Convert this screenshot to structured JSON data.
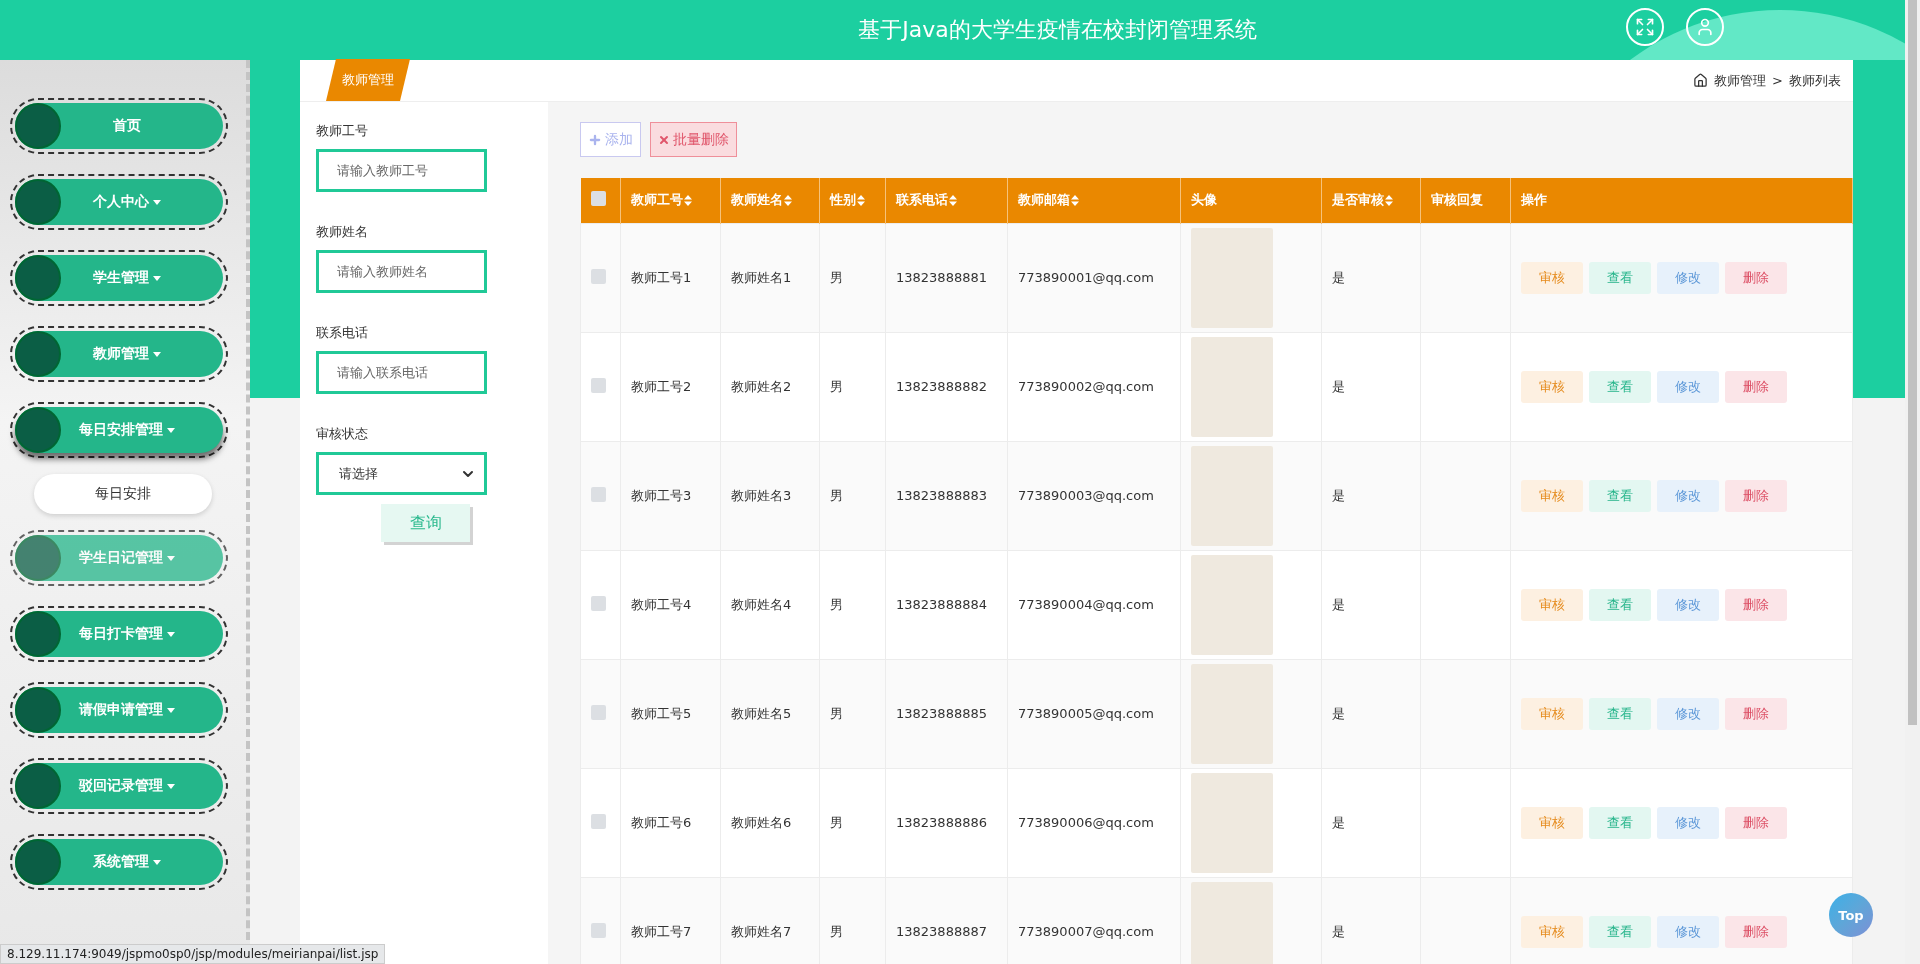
{
  "header": {
    "title": "基于Java的大学生疫情在校封闭管理系统"
  },
  "sidebar": {
    "items": [
      {
        "label": "首页",
        "dropdown": false,
        "expanded": false,
        "hovered": false
      },
      {
        "label": "个人中心",
        "dropdown": true,
        "expanded": false,
        "hovered": false
      },
      {
        "label": "学生管理",
        "dropdown": true,
        "expanded": false,
        "hovered": false
      },
      {
        "label": "教师管理",
        "dropdown": true,
        "expanded": false,
        "hovered": false
      },
      {
        "label": "每日安排管理",
        "dropdown": true,
        "expanded": true,
        "hovered": false,
        "children": [
          {
            "label": "每日安排"
          }
        ]
      },
      {
        "label": "学生日记管理",
        "dropdown": true,
        "expanded": false,
        "hovered": true
      },
      {
        "label": "每日打卡管理",
        "dropdown": true,
        "expanded": false,
        "hovered": false
      },
      {
        "label": "请假申请管理",
        "dropdown": true,
        "expanded": false,
        "hovered": false
      },
      {
        "label": "驳回记录管理",
        "dropdown": true,
        "expanded": false,
        "hovered": false
      },
      {
        "label": "系统管理",
        "dropdown": true,
        "expanded": false,
        "hovered": false
      }
    ]
  },
  "tab": {
    "label": "教师管理"
  },
  "breadcrumb": {
    "items": [
      "教师管理",
      "教师列表"
    ],
    "separator": ">"
  },
  "filters": [
    {
      "kind": "text",
      "label": "教师工号",
      "placeholder": "请输入教师工号"
    },
    {
      "kind": "text",
      "label": "教师姓名",
      "placeholder": "请输入教师姓名"
    },
    {
      "kind": "text",
      "label": "联系电话",
      "placeholder": "请输入联系电话"
    },
    {
      "kind": "select",
      "label": "审核状态",
      "value": "请选择"
    }
  ],
  "search_button": "查询",
  "toolbar": [
    {
      "kind": "add",
      "label": "添加"
    },
    {
      "kind": "delete",
      "label": "批量删除"
    }
  ],
  "table": {
    "select_all_checked": false,
    "columns": [
      {
        "label": "教师工号",
        "sortable": true
      },
      {
        "label": "教师姓名",
        "sortable": true
      },
      {
        "label": "性别",
        "sortable": true
      },
      {
        "label": "联系电话",
        "sortable": true
      },
      {
        "label": "教师邮箱",
        "sortable": true
      },
      {
        "label": "头像",
        "sortable": false
      },
      {
        "label": "是否审核",
        "sortable": true
      },
      {
        "label": "审核回复",
        "sortable": false
      },
      {
        "label": "操作",
        "sortable": false
      }
    ],
    "rows": [
      {
        "checked": false,
        "teacher_id": "教师工号1",
        "name": "教师姓名1",
        "gender": "男",
        "phone": "13823888881",
        "email": "773890001@qq.com",
        "reviewed": "是",
        "actions": [
          {
            "kind": "audit",
            "label": "审核"
          },
          {
            "kind": "view",
            "label": "查看"
          },
          {
            "kind": "edit",
            "label": "修改"
          },
          {
            "kind": "delete",
            "label": "删除"
          }
        ]
      },
      {
        "checked": false,
        "teacher_id": "教师工号2",
        "name": "教师姓名2",
        "gender": "男",
        "phone": "13823888882",
        "email": "773890002@qq.com",
        "reviewed": "是",
        "actions": [
          {
            "kind": "audit",
            "label": "审核"
          },
          {
            "kind": "view",
            "label": "查看"
          },
          {
            "kind": "edit",
            "label": "修改"
          },
          {
            "kind": "delete",
            "label": "删除"
          }
        ]
      },
      {
        "checked": false,
        "teacher_id": "教师工号3",
        "name": "教师姓名3",
        "gender": "男",
        "phone": "13823888883",
        "email": "773890003@qq.com",
        "reviewed": "是",
        "actions": [
          {
            "kind": "audit",
            "label": "审核"
          },
          {
            "kind": "view",
            "label": "查看"
          },
          {
            "kind": "edit",
            "label": "修改"
          },
          {
            "kind": "delete",
            "label": "删除"
          }
        ]
      },
      {
        "checked": false,
        "teacher_id": "教师工号4",
        "name": "教师姓名4",
        "gender": "男",
        "phone": "13823888884",
        "email": "773890004@qq.com",
        "reviewed": "是",
        "actions": [
          {
            "kind": "audit",
            "label": "审核"
          },
          {
            "kind": "view",
            "label": "查看"
          },
          {
            "kind": "edit",
            "label": "修改"
          },
          {
            "kind": "delete",
            "label": "删除"
          }
        ]
      },
      {
        "checked": false,
        "teacher_id": "教师工号5",
        "name": "教师姓名5",
        "gender": "男",
        "phone": "13823888885",
        "email": "773890005@qq.com",
        "reviewed": "是",
        "actions": [
          {
            "kind": "audit",
            "label": "审核"
          },
          {
            "kind": "view",
            "label": "查看"
          },
          {
            "kind": "edit",
            "label": "修改"
          },
          {
            "kind": "delete",
            "label": "删除"
          }
        ]
      },
      {
        "checked": false,
        "teacher_id": "教师工号6",
        "name": "教师姓名6",
        "gender": "男",
        "phone": "13823888886",
        "email": "773890006@qq.com",
        "reviewed": "是",
        "actions": [
          {
            "kind": "audit",
            "label": "审核"
          },
          {
            "kind": "view",
            "label": "查看"
          },
          {
            "kind": "edit",
            "label": "修改"
          },
          {
            "kind": "delete",
            "label": "删除"
          }
        ]
      },
      {
        "checked": false,
        "teacher_id": "教师工号7",
        "name": "教师姓名7",
        "gender": "男",
        "phone": "13823888887",
        "email": "773890007@qq.com",
        "reviewed": "是",
        "actions": [
          {
            "kind": "audit",
            "label": "审核"
          },
          {
            "kind": "view",
            "label": "查看"
          },
          {
            "kind": "edit",
            "label": "修改"
          },
          {
            "kind": "delete",
            "label": "删除"
          }
        ]
      }
    ]
  },
  "status_url": "8.129.11.174:9049/jspmo0sp0/jsp/modules/meirianpai/list.jsp",
  "top_button": "Top"
}
